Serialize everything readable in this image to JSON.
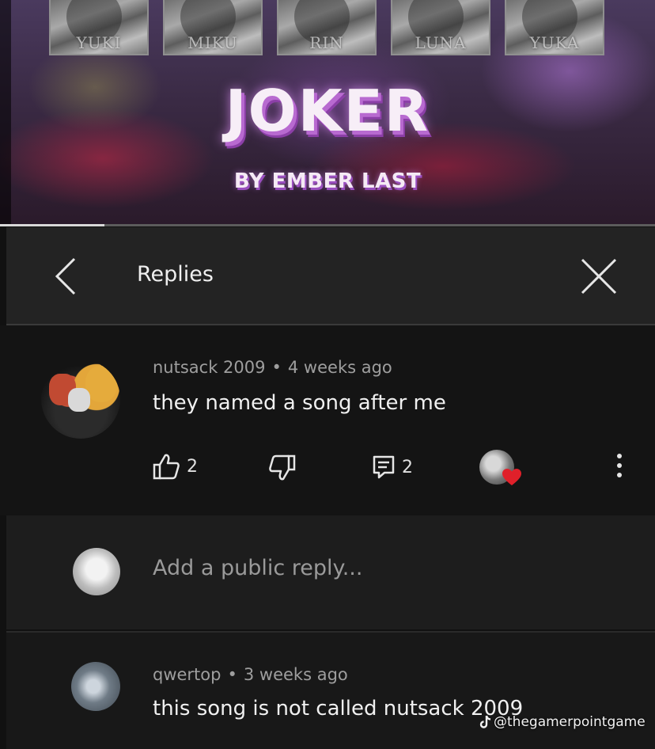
{
  "video": {
    "thumbnails": [
      "YUKI",
      "MIKU",
      "RIN",
      "LUNA",
      "YUKA"
    ],
    "song_title": "JOKER",
    "song_artist": "BY EMBER LAST",
    "progress": 0.16
  },
  "header": {
    "title": "Replies",
    "back_icon": "chevron-left-icon",
    "close_icon": "close-icon"
  },
  "comment": {
    "author": "nutsack 2009",
    "separator": "•",
    "time": "4 weeks ago",
    "text": "they named a song after me",
    "likes": "2",
    "replies": "2"
  },
  "add_reply": {
    "placeholder": "Add a public reply..."
  },
  "reply": {
    "author": "qwertop",
    "separator": "•",
    "time": "3 weeks ago",
    "text": "this song is not called nutsack 2009"
  },
  "watermark": {
    "text": "@thegamerpointgame"
  },
  "colors": {
    "heart": "#e0202a",
    "title_shadow": "#b86ad0",
    "background": "#111111"
  }
}
